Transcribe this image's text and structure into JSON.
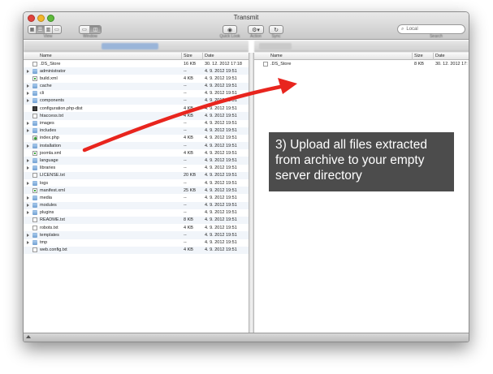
{
  "window": {
    "title": "Transmit",
    "toolbar": {
      "view_label": "View",
      "window_label": "Window",
      "quicklook_label": "Quick Look",
      "action_label": "Action",
      "sync_label": "Sync",
      "search_placeholder": "Local",
      "search_label": "Search",
      "icons": [
        "grid-view-icon",
        "list-view-icon",
        "column-view-icon",
        "coverflow-view-icon",
        "single-pane-icon",
        "dual-pane-icon",
        "eye-icon",
        "gear-icon",
        "refresh-icon",
        "search-icon"
      ]
    }
  },
  "left_pane": {
    "columns": {
      "name": "Name",
      "size": "Size",
      "date": "Date"
    },
    "rows": [
      {
        "name": ".DS_Store",
        "size": "16 KB",
        "date": "30. 12. 2012 17:18",
        "icon": "file",
        "folder": false
      },
      {
        "name": "administrator",
        "size": "--",
        "date": "4. 9. 2012 19:51",
        "icon": "folder",
        "folder": true
      },
      {
        "name": "build.xml",
        "size": "4 KB",
        "date": "4. 9. 2012 19:51",
        "icon": "xml",
        "folder": false
      },
      {
        "name": "cache",
        "size": "--",
        "date": "4. 9. 2012 19:51",
        "icon": "folder",
        "folder": true
      },
      {
        "name": "cli",
        "size": "--",
        "date": "4. 9. 2012 19:51",
        "icon": "folder",
        "folder": true
      },
      {
        "name": "components",
        "size": "--",
        "date": "4. 9. 2012 19:51",
        "icon": "folder",
        "folder": true
      },
      {
        "name": "configuration.php-dist",
        "size": "4 KB",
        "date": "4. 9. 2012 19:51",
        "icon": "dark",
        "folder": false
      },
      {
        "name": "htaccess.txt",
        "size": "4 KB",
        "date": "4. 9. 2012 19:51",
        "icon": "file",
        "folder": false
      },
      {
        "name": "images",
        "size": "--",
        "date": "4. 9. 2012 19:51",
        "icon": "folder",
        "folder": true
      },
      {
        "name": "includes",
        "size": "--",
        "date": "4. 9. 2012 19:51",
        "icon": "folder",
        "folder": true
      },
      {
        "name": "index.php",
        "size": "4 KB",
        "date": "4. 9. 2012 19:51",
        "icon": "php",
        "folder": false
      },
      {
        "name": "installation",
        "size": "--",
        "date": "4. 9. 2012 19:51",
        "icon": "folder",
        "folder": true
      },
      {
        "name": "joomla.xml",
        "size": "4 KB",
        "date": "4. 9. 2012 19:51",
        "icon": "xml",
        "folder": false
      },
      {
        "name": "language",
        "size": "--",
        "date": "4. 9. 2012 19:51",
        "icon": "folder",
        "folder": true
      },
      {
        "name": "libraries",
        "size": "--",
        "date": "4. 9. 2012 19:51",
        "icon": "folder",
        "folder": true
      },
      {
        "name": "LICENSE.txt",
        "size": "20 KB",
        "date": "4. 9. 2012 19:51",
        "icon": "file",
        "folder": false
      },
      {
        "name": "logs",
        "size": "--",
        "date": "4. 9. 2012 19:51",
        "icon": "folder",
        "folder": true
      },
      {
        "name": "manifest.xml",
        "size": "25 KB",
        "date": "4. 9. 2012 19:51",
        "icon": "xml",
        "folder": false
      },
      {
        "name": "media",
        "size": "--",
        "date": "4. 9. 2012 19:51",
        "icon": "folder",
        "folder": true
      },
      {
        "name": "modules",
        "size": "--",
        "date": "4. 9. 2012 19:51",
        "icon": "folder",
        "folder": true
      },
      {
        "name": "plugins",
        "size": "--",
        "date": "4. 9. 2012 19:51",
        "icon": "folder",
        "folder": true
      },
      {
        "name": "README.txt",
        "size": "8 KB",
        "date": "4. 9. 2012 19:51",
        "icon": "file",
        "folder": false
      },
      {
        "name": "robots.txt",
        "size": "4 KB",
        "date": "4. 9. 2012 19:51",
        "icon": "file",
        "folder": false
      },
      {
        "name": "templates",
        "size": "--",
        "date": "4. 9. 2012 19:51",
        "icon": "folder",
        "folder": true
      },
      {
        "name": "tmp",
        "size": "--",
        "date": "4. 9. 2012 19:51",
        "icon": "folder",
        "folder": true
      },
      {
        "name": "web.config.txt",
        "size": "4 KB",
        "date": "4. 9. 2012 19:51",
        "icon": "file",
        "folder": false
      }
    ]
  },
  "right_pane": {
    "columns": {
      "name": "Name",
      "size": "Size",
      "date": "Date"
    },
    "rows": [
      {
        "name": ".DS_Store",
        "size": "8 KB",
        "date": "30. 12. 2012 17:",
        "icon": "file",
        "folder": false
      }
    ]
  },
  "callout": {
    "text": "3) Upload all files extracted from archive to your empty server directory",
    "background": "#4c4c4c"
  },
  "colors": {
    "arrow": "#e8251e",
    "folder": "#7aa7d6",
    "row_alt": "#f1f5fa"
  }
}
